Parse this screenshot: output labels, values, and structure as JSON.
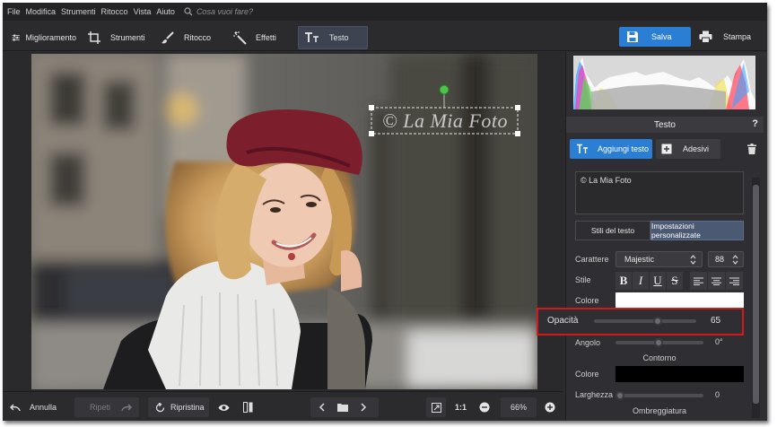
{
  "menu": [
    "File",
    "Modifica",
    "Strumenti",
    "Ritocco",
    "Vista",
    "Aiuto"
  ],
  "search": {
    "placeholder": "Cosa vuoi fare?"
  },
  "tabs": {
    "miglioramento": "Miglioramento",
    "strumenti": "Strumenti",
    "ritocco": "Ritocco",
    "effetti": "Effetti",
    "testo": "Testo"
  },
  "actions": {
    "save": "Salva",
    "print": "Stampa"
  },
  "canvas": {
    "watermark_text": "© La Mia Foto"
  },
  "panel": {
    "title": "Testo",
    "help": "?",
    "add_text": "Aggiungi testo",
    "stickers": "Adesivi",
    "text_value": "© La Mia Foto",
    "tab_styles": "Stili del testo",
    "tab_custom": "Impostazioni personalizzate",
    "font_label": "Carattere",
    "font_value": "Majestic",
    "font_size": "88",
    "style_label": "Stile",
    "color_label": "Colore",
    "text_color": "#ffffff",
    "opacity_label": "Opacità",
    "opacity_value": "65",
    "angle_label": "Angolo",
    "angle_value": "0°",
    "outline_header": "Contorno",
    "outline_color_label": "Colore",
    "outline_color": "#000000",
    "width_label": "Larghezza",
    "width_value": "0",
    "shadow_header": "Ombreggiatura"
  },
  "bottom": {
    "undo": "Annulla",
    "redo": "Ripeti",
    "reset": "Ripristina",
    "ratio": "1:1",
    "zoom": "66%"
  },
  "colors": {
    "accent": "#2a7ed3",
    "highlight": "#d4191c"
  }
}
